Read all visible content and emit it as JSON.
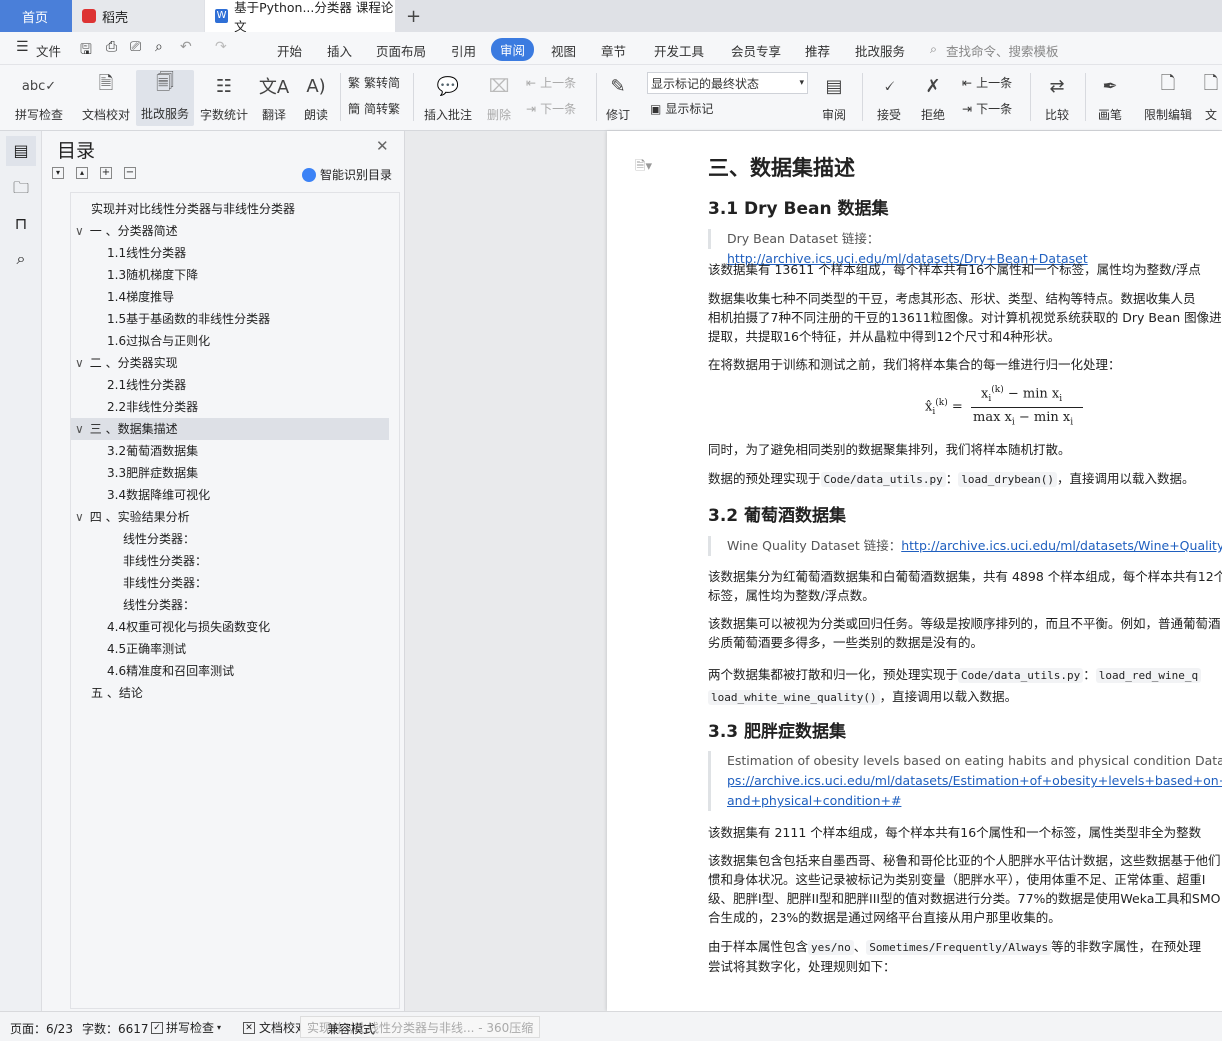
{
  "tabs": {
    "home": "首页",
    "daoke": "稻壳",
    "doc": "基于Python...分类器 课程论文",
    "add": "+"
  },
  "menu": {
    "file": "文件",
    "items": [
      "开始",
      "插入",
      "页面布局",
      "引用",
      "审阅",
      "视图",
      "章节",
      "开发工具",
      "会员专享",
      "推荐",
      "批改服务"
    ],
    "search": "查找命令、搜索模板"
  },
  "ribbon": {
    "spell": "拼写检查",
    "proof": "文档校对",
    "correct": "批改服务",
    "wordcount": "字数统计",
    "translate": "翻译",
    "read": "朗读",
    "trad": "繁转简",
    "simp": "简转繁",
    "insert_comment": "插入批注",
    "delete": "删除",
    "prev": "上一条",
    "next": "下一条",
    "revise": "修订",
    "markup_state": "显示标记的最终状态",
    "show_markup": "显示标记",
    "review": "审阅",
    "accept": "接受",
    "reject": "拒绝",
    "prev2": "上一条",
    "next2": "下一条",
    "compare": "比较",
    "pen": "画笔",
    "restrict": "限制编辑",
    "doc_more": "文"
  },
  "nav": {
    "title": "目录",
    "smart": "智能识别目录",
    "items": [
      {
        "t": "实现并对比线性分类器与非线性分类器"
      },
      {
        "t": "一 、分类器简述"
      },
      {
        "t": "1.1线性分类器"
      },
      {
        "t": "1.3随机梯度下降"
      },
      {
        "t": "1.4梯度推导"
      },
      {
        "t": "1.5基于基函数的非线性分类器"
      },
      {
        "t": "1.6过拟合与正则化"
      },
      {
        "t": "二 、分类器实现"
      },
      {
        "t": "2.1线性分类器"
      },
      {
        "t": "2.2非线性分类器"
      },
      {
        "t": "三 、数据集描述"
      },
      {
        "t": "3.2葡萄酒数据集"
      },
      {
        "t": "3.3肥胖症数据集"
      },
      {
        "t": "3.4数据降维可视化"
      },
      {
        "t": "四 、实验结果分析"
      },
      {
        "t": "线性分类器："
      },
      {
        "t": "非线性分类器："
      },
      {
        "t": "非线性分类器："
      },
      {
        "t": "线性分类器："
      },
      {
        "t": "4.4权重可视化与损失函数变化"
      },
      {
        "t": "4.5正确率测试"
      },
      {
        "t": "4.6精准度和召回率测试"
      },
      {
        "t": "五 、结论"
      }
    ]
  },
  "doc": {
    "h_section": "三、数据集描述",
    "h31": "3.1 Dry Bean 数据集",
    "q31_label": "Dry Bean Dataset 链接：",
    "q31_link": "http://archive.ics.uci.edu/ml/datasets/Dry+Bean+Dataset",
    "p1": "该数据集有 13611 个样本组成，每个样本共有16个属性和一个标签，属性均为整数/浮点",
    "p2a": "数据集收集七种不同类型的干豆，考虑其形态、形状、类型、结构等特点。数据收集人员",
    "p2b": "相机拍摄了7种不同注册的干豆的13611粒图像。对计算机视觉系统获取的 Dry Bean 图像进",
    "p2c": "提取，共提取16个特征，并从晶粒中得到12个尺寸和4种形状。",
    "p3": "在将数据用于训练和测试之前，我们将样本集合的每一维进行归一化处理：",
    "p4": "同时，为了避免相同类别的数据聚集排列，我们将样本随机打散。",
    "p5a": "数据的预处理实现于",
    "p5code1": "Code/data_utils.py",
    "p5b": "：",
    "p5code2": "load_drybean()",
    "p5c": "，直接调用以载入数据。",
    "h32": "3.2 葡萄酒数据集",
    "q32_label": "Wine Quality Dataset 链接：",
    "q32_link": "http://archive.ics.uci.edu/ml/datasets/Wine+Quality",
    "p6a": "该数据集分为红葡萄酒数据集和白葡萄酒数据集，共有 4898 个样本组成，每个样本共有12个",
    "p6b": "标签，属性均为整数/浮点数。",
    "p7a": "该数据集可以被视为分类或回归任务。等级是按顺序排列的，而且不平衡。例如，普通葡萄酒",
    "p7b": "劣质葡萄酒要多得多，一些类别的数据是没有的。",
    "p8a": "两个数据集都被打散和归一化，预处理实现于",
    "p8code1": "Code/data_utils.py",
    "p8b": "：",
    "p8code2": "load_red_wine_q",
    "p9code": "load_white_wine_quality()",
    "p9b": "，直接调用以载入数据。",
    "h33": "3.3 肥胖症数据集",
    "q33a": "Estimation of obesity levels based on eating habits and physical condition Data Set",
    "q33b": "ps://archive.ics.uci.edu/ml/datasets/Estimation+of+obesity+levels+based+on+eating+",
    "q33c": "and+physical+condition+#",
    "p10": "该数据集有 2111 个样本组成，每个样本共有16个属性和一个标签，属性类型非全为整数",
    "p11a": "该数据集包含包括来自墨西哥、秘鲁和哥伦比亚的个人肥胖水平估计数据，这些数据基于他们",
    "p11b": "惯和身体状况。这些记录被标记为类别变量（肥胖水平），使用体重不足、正常体重、超重I",
    "p11c": "级、肥胖I型、肥胖II型和肥胖III型的值对数据进行分类。77%的数据是使用Weka工具和SMO",
    "p11d": "合生成的，23%的数据是通过网络平台直接从用户那里收集的。",
    "p12a": "由于样本属性包含",
    "p12code1": "yes/no",
    "p12b": "、",
    "p12code2": "Sometimes/Frequently/Always",
    "p12c": "等的非数字属性，在预处理",
    "p13": "尝试将其数字化，处理规则如下："
  },
  "status": {
    "page": "页面：6/23",
    "words": "字数：6617",
    "spell": "拼写检查",
    "proof": "文档校对",
    "compat": "兼容模式",
    "tooltip": "实现并对比线性分类器与非线... - 360压缩"
  }
}
